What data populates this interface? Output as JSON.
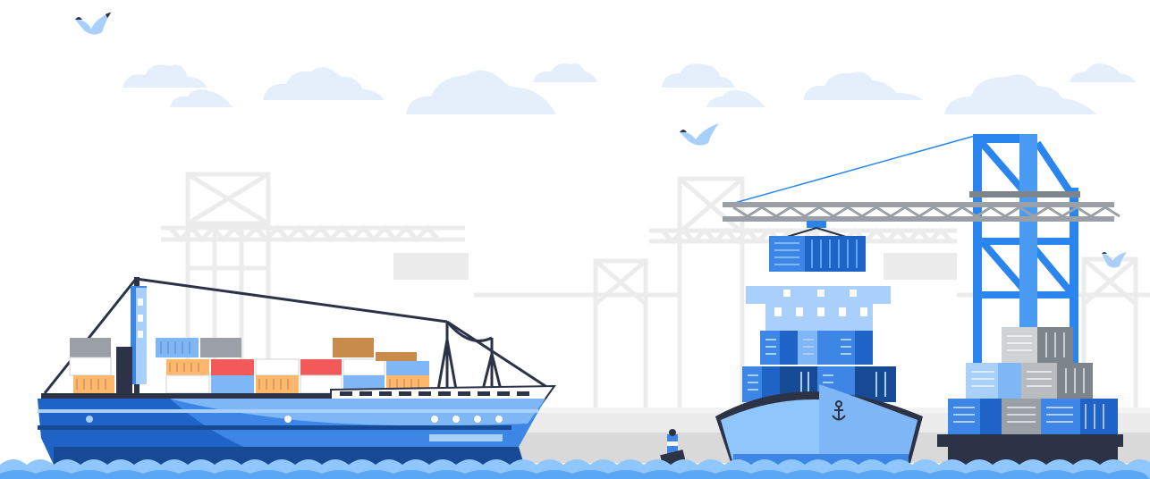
{
  "scene": {
    "subject": "port-illustration",
    "colors": {
      "sky_cloud": "#e4effb",
      "bg_structure": "#ececec",
      "navy": "#2c3347",
      "blue_dark": "#1f63c6",
      "blue_mid": "#3d86e6",
      "blue_light": "#7eb6f6",
      "blue_pale": "#a9d0fb",
      "crane_blue": "#2a86ee",
      "crane_gray": "#9aa0a6",
      "container_orange": "#ffb86b",
      "container_red": "#f25a5a",
      "container_brown": "#c98b4b",
      "water": "#8fc6fb",
      "water_dark": "#5aa8f5"
    },
    "icons": [
      "seagull-icon",
      "anchor-icon",
      "buoy-icon",
      "crane-icon",
      "cloud-icon"
    ]
  }
}
